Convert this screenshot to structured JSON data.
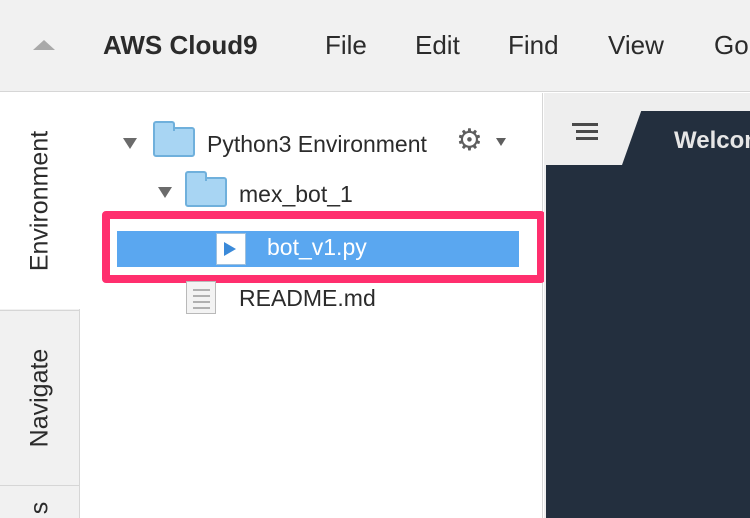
{
  "menubar": {
    "app_title": "AWS Cloud9",
    "items": [
      "File",
      "Edit",
      "Find",
      "View",
      "Go"
    ]
  },
  "rail": {
    "tabs": [
      {
        "label": "Environment",
        "active": true
      },
      {
        "label": "Navigate",
        "active": false
      },
      {
        "label": "s",
        "active": false
      }
    ]
  },
  "tree": {
    "root": {
      "label": "Python3 Environment",
      "icon": "folder-icon"
    },
    "folder": {
      "label": "mex_bot_1",
      "icon": "folder-icon"
    },
    "files": [
      {
        "label": "bot_v1.py",
        "icon": "python-file-icon",
        "selected": true
      },
      {
        "label": "README.md",
        "icon": "text-file-icon",
        "selected": false
      }
    ],
    "settings_icon": "gear-icon"
  },
  "editor": {
    "tab_label": "Welcome"
  },
  "colors": {
    "selection": "#5aa7f0",
    "highlight": "#ff2f6e",
    "editor_bg": "#232f3e",
    "folder": "#a8d5f3"
  }
}
